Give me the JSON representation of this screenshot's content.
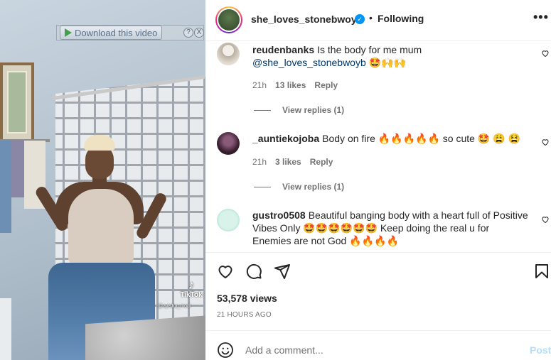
{
  "media": {
    "download_label": "Download this video",
    "download_help": "?",
    "download_close": "X",
    "watermark_brand": "TikTok",
    "watermark_user": "@ayisha_modi"
  },
  "header": {
    "username": "she_loves_stonebwoyb",
    "separator": "•",
    "follow_status": "Following",
    "more": "•••"
  },
  "comments": [
    {
      "username": "reudenbanks",
      "text": "Is the body for me mum",
      "mention": "@she_loves_stonebwoyb",
      "emojis": "🤩🙌🙌",
      "time": "21h",
      "likes": "13 likes",
      "reply": "Reply",
      "view_replies": "View replies (1)"
    },
    {
      "username": "_auntiekojoba",
      "text": "Body on fire 🔥🔥🔥🔥🔥 so cute 🤩 😩 😫",
      "time": "21h",
      "likes": "3 likes",
      "reply": "Reply",
      "view_replies": "View replies (1)"
    },
    {
      "username": "gustro0508",
      "text": "Beautiful banging body with a heart full of Positive Vibes Only 🤩🤩🤩🤩🤩🤩 Keep doing the real u for Enemies are not God 🔥🔥🔥🔥"
    }
  ],
  "stats": {
    "views": "53,578 views",
    "timestamp": "21 HOURS AGO"
  },
  "add_comment": {
    "placeholder": "Add a comment...",
    "post_label": "Post"
  },
  "colors": {
    "link": "#00376b",
    "verified": "#0095f6",
    "post_disabled": "#b2dffc",
    "secondary_text": "#737373"
  }
}
